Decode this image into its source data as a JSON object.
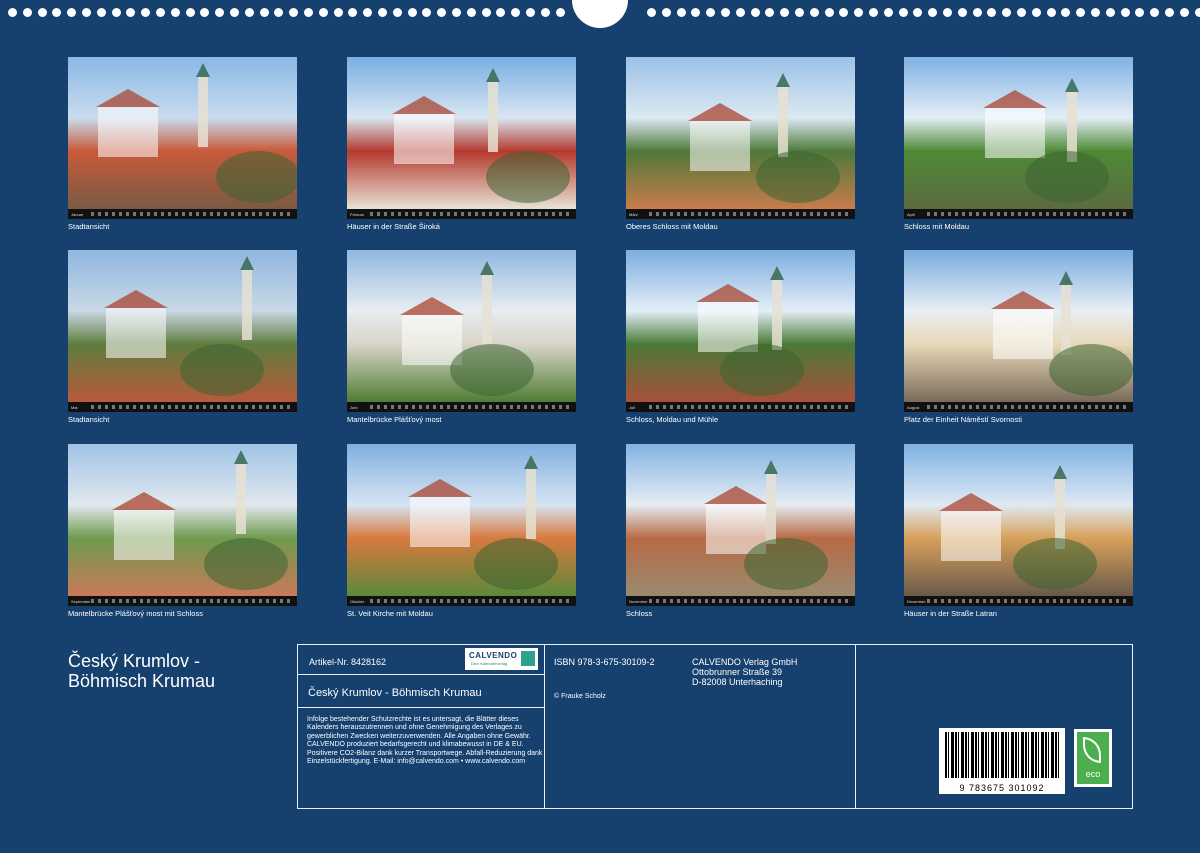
{
  "title": {
    "line1": "Český Krumlov -",
    "line2": "Böhmisch Krumau"
  },
  "thumbnails": [
    {
      "caption": "Stadtansicht",
      "month": "Januar"
    },
    {
      "caption": "Häuser in der Straße Široká",
      "month": "Februar"
    },
    {
      "caption": "Oberes Schloss mit Moldau",
      "month": "März"
    },
    {
      "caption": "Schloss  mit Moldau",
      "month": "April"
    },
    {
      "caption": "Stadtansicht",
      "month": "Mai"
    },
    {
      "caption": "Mantelbrücke Plášťový most",
      "month": "Juni"
    },
    {
      "caption": "Schloss, Moldau und Mühle",
      "month": "Juli"
    },
    {
      "caption": "Platz der Einheit Náměstí Svornosti",
      "month": "August"
    },
    {
      "caption": "Mantelbrücke Plášťový most mit Schloss",
      "month": "September"
    },
    {
      "caption": "St. Veit Kirche mit Moldau",
      "month": "Oktober"
    },
    {
      "caption": "Schloss",
      "month": "November"
    },
    {
      "caption": "Häuser in der Straße Latran",
      "month": "Dezember"
    }
  ],
  "info": {
    "article": "Artikel-Nr. 8428162",
    "logo_text": "CALVENDO",
    "logo_sub": "Dein Kalenderverlag",
    "product_title": "Český Krumlov - Böhmisch Krumau",
    "legal": "Infolge bestehender Schutzrechte ist es untersagt, die Blätter dieses Kalenders herauszutrennen und ohne Genehmigung des Verlages zu gewerblichen Zwecken weiterzuverwenden. Alle Angaben ohne Gewähr. CALVENDO produziert bedarfsgerecht und klimabewusst in DE & EU. Positivere CO2-Bilanz dank kurzer Transportwege. Abfall-Reduzierung dank Einzelstückfertigung. E-Mail: info@calvendo.com • www.calvendo.com",
    "isbn": "ISBN 978-3-675-30109-2",
    "copyright": "© Frauke Scholz",
    "publisher_name": "CALVENDO Verlag GmbH",
    "publisher_street": "Ottobrunner Straße 39",
    "publisher_city": "D-82008 Unterhaching",
    "barcode_number": "9 783675 301092",
    "eco_label": "eco"
  }
}
